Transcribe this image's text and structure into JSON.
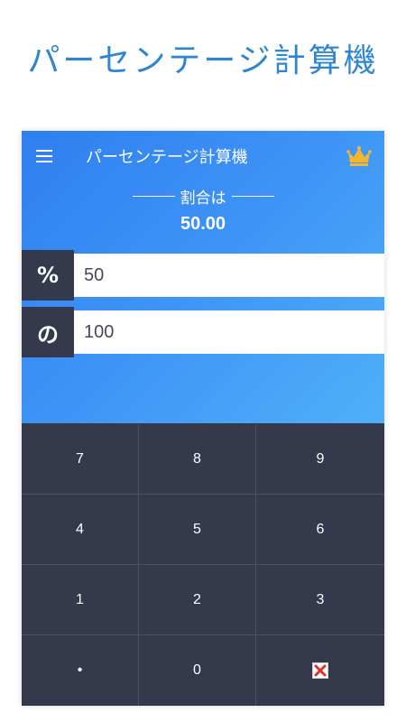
{
  "promo": {
    "title": "パーセンテージ計算機"
  },
  "appbar": {
    "title": "パーセンテージ計算機"
  },
  "result": {
    "label": "割合は",
    "value": "50.00"
  },
  "inputs": {
    "percent": {
      "label": "%",
      "value": "50"
    },
    "of": {
      "label": "の",
      "value": "100"
    }
  },
  "keypad": {
    "keys": [
      "7",
      "8",
      "9",
      "4",
      "5",
      "6",
      "1",
      "2",
      "3",
      "•",
      "0"
    ]
  },
  "colors": {
    "promo_text": "#2f86d0",
    "hero_start": "#2f7ff0",
    "hero_end": "#4fb0f9",
    "keypad_bg": "#343a4b",
    "crown": "#f5b731",
    "clear": "#d9342b"
  },
  "icons": {
    "menu": "menu-icon",
    "premium": "crown-icon",
    "clear": "clear-icon"
  }
}
